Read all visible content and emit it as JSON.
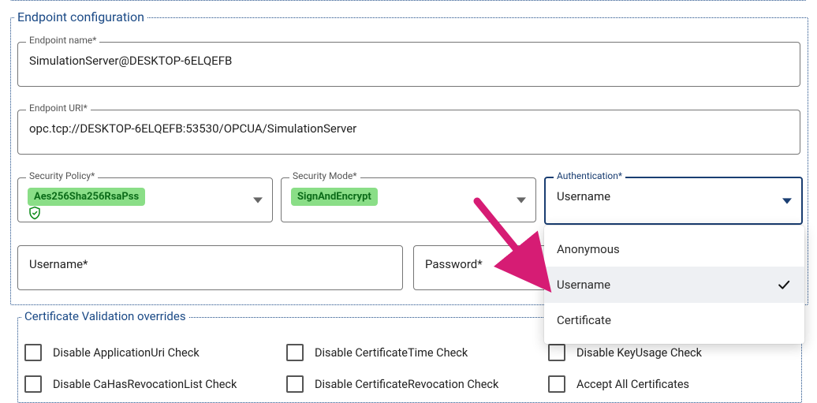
{
  "section": {
    "title": "Endpoint configuration"
  },
  "endpoint_name": {
    "label": "Endpoint name*",
    "value": "SimulationServer@DESKTOP-6ELQEFB"
  },
  "endpoint_uri": {
    "label": "Endpoint URI*",
    "value": "opc.tcp://DESKTOP-6ELQEFB:53530/OPCUA/SimulationServer"
  },
  "security_policy": {
    "label": "Security Policy*",
    "value": "Aes256Sha256RsaPss"
  },
  "security_mode": {
    "label": "Security Mode*",
    "value": "SignAndEncrypt"
  },
  "authentication": {
    "label": "Authentication*",
    "value": "Username",
    "options": [
      "Anonymous",
      "Username",
      "Certificate"
    ],
    "selected_index": 1
  },
  "username": {
    "placeholder": "Username*"
  },
  "password": {
    "placeholder": "Password*"
  },
  "cert_overrides": {
    "title": "Certificate Validation overrides",
    "items": [
      "Disable ApplicationUri Check",
      "Disable CertificateTime Check",
      "Disable KeyUsage Check",
      "Disable CaHasRevocationList Check",
      "Disable CertificateRevocation Check",
      "Accept All Certificates"
    ]
  },
  "colors": {
    "accent": "#1b4a86",
    "chip_bg": "#8ade87",
    "chip_text": "#0b6b18",
    "arrow": "#d61c74"
  }
}
